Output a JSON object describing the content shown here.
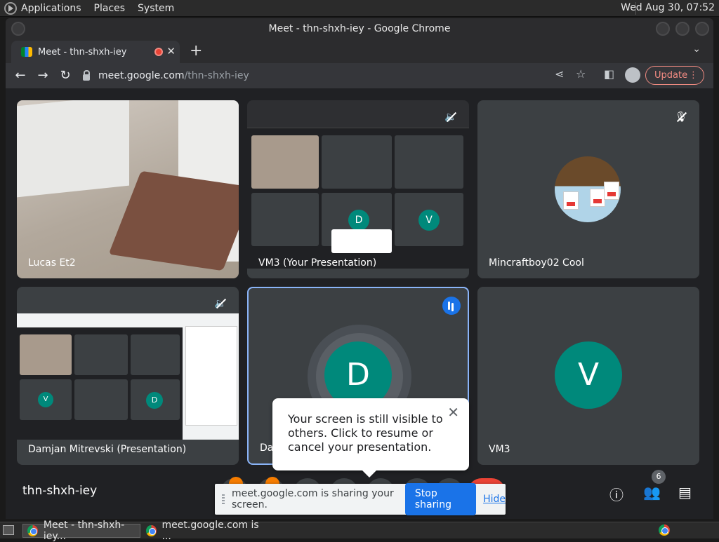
{
  "os": {
    "menus": [
      "Applications",
      "Places",
      "System"
    ],
    "clock": "Wed Aug 30, 07:52"
  },
  "window": {
    "title": "Meet - thn-shxh-iey - Google Chrome"
  },
  "tab": {
    "title": "Meet - thn-shxh-iey",
    "close": "✕",
    "new_tab": "+"
  },
  "omnibox": {
    "host": "meet.google.com",
    "path": "/thn-shxh-iey"
  },
  "toolbar": {
    "update_label": "Update"
  },
  "tiles": [
    {
      "name": "Lucas Et2"
    },
    {
      "name": "VM3 (Your Presentation)"
    },
    {
      "name": "Mincraftboy02 Cool"
    },
    {
      "name": "Damjan Mitrevski (Presentation)"
    },
    {
      "name": "Da",
      "initial": "D"
    },
    {
      "name": "VM3",
      "initial": "V"
    }
  ],
  "popup": {
    "text": "Your screen is still visible to others. Click to resume or cancel your presentation.",
    "close": "✕"
  },
  "meeting": {
    "code": "thn-shxh-iey",
    "people_count": "6"
  },
  "share_banner": {
    "text": "meet.google.com is sharing your screen.",
    "stop_label": "Stop sharing",
    "hide_label": "Hide"
  },
  "taskbar": {
    "items": [
      "Meet - thn-shxh-iey...",
      "meet.google.com is ..."
    ]
  },
  "colors": {
    "accent_blue": "#1a73e8",
    "avatar_teal": "#00897b",
    "end_call_red": "#ea4335"
  }
}
